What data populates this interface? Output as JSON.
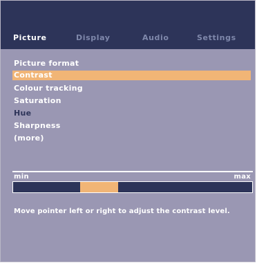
{
  "tabs": [
    {
      "label": "Picture",
      "active": true
    },
    {
      "label": "Display",
      "active": false
    },
    {
      "label": "Audio",
      "active": false
    },
    {
      "label": "Settings",
      "active": false
    }
  ],
  "menu": {
    "items": [
      {
        "label": "Picture format",
        "state": "normal"
      },
      {
        "label": "Contrast",
        "state": "selected"
      },
      {
        "label": "Colour tracking",
        "state": "normal"
      },
      {
        "label": "Saturation",
        "state": "normal"
      },
      {
        "label": "Hue",
        "state": "disabled"
      },
      {
        "label": "Sharpness",
        "state": "normal"
      },
      {
        "label": "(more)",
        "state": "normal"
      }
    ]
  },
  "slider": {
    "min_label": "min",
    "max_label": "max",
    "value_fraction_start": 0.28,
    "value_fraction_end": 0.44
  },
  "hint": "Move pointer left or right to adjust the contrast level.",
  "colors": {
    "background": "#9a97b3",
    "header": "#2d3459",
    "accent": "#f1b576",
    "text": "#ffffff",
    "inactive_tab": "#7f88ab"
  }
}
